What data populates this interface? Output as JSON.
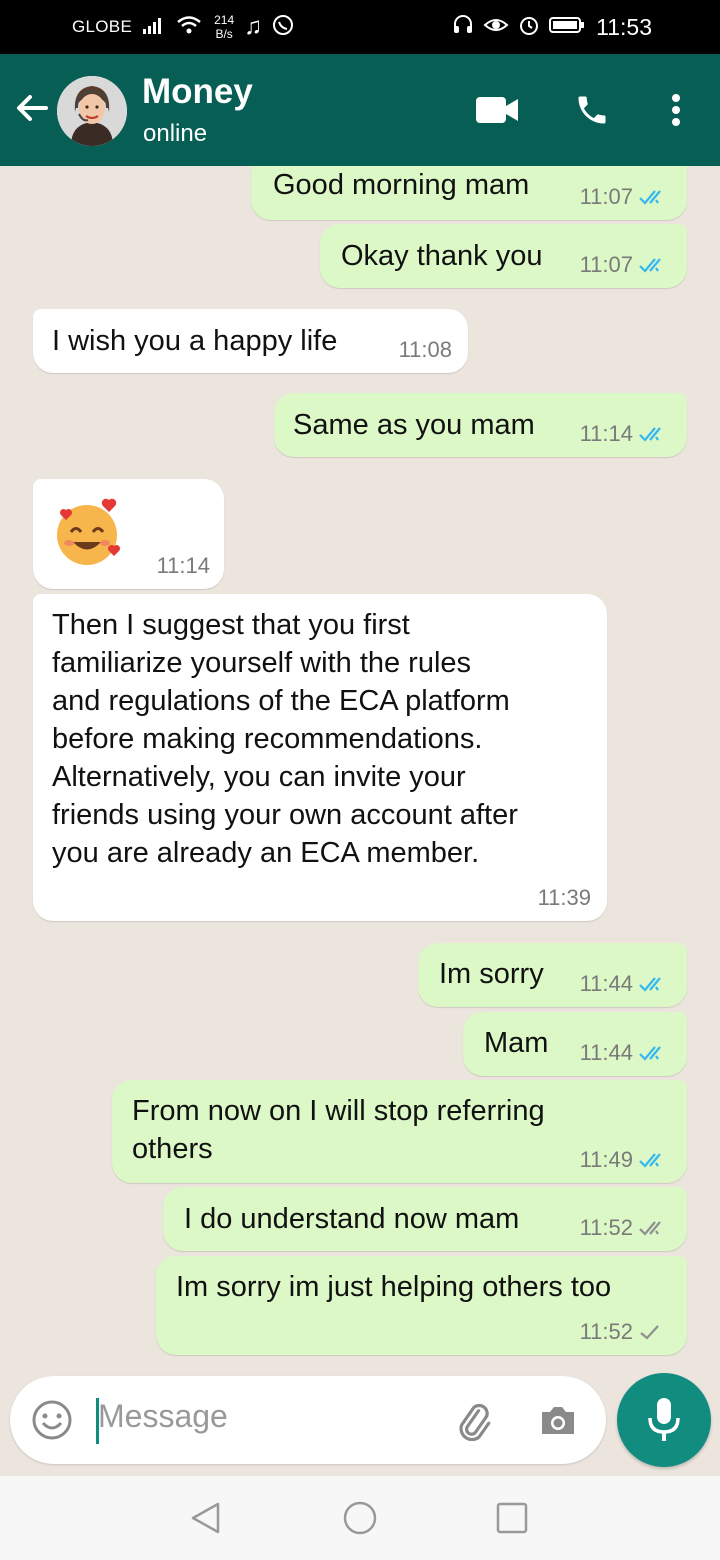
{
  "status_bar": {
    "carrier": "GLOBE",
    "speed_value": "214",
    "speed_unit": "B/s",
    "time": "11:53",
    "icons": [
      "signal-icon",
      "wifi-icon",
      "music-icon",
      "whatsapp-icon",
      "headset-icon",
      "eye-icon",
      "alarm-icon",
      "battery-icon"
    ]
  },
  "header": {
    "contact_name": "Money",
    "presence": "online",
    "icons": [
      "back-arrow-icon",
      "video-call-icon",
      "phone-icon",
      "more-vert-icon"
    ]
  },
  "messages": [
    {
      "dir": "out",
      "text": "Good morning mam",
      "time": "11:07",
      "ticks": "read"
    },
    {
      "dir": "out",
      "text": "Okay thank you",
      "time": "11:07",
      "ticks": "read"
    },
    {
      "dir": "in",
      "text": "I wish you a happy life",
      "time": "11:08"
    },
    {
      "dir": "out",
      "text": "Same as you mam",
      "time": "11:14",
      "ticks": "read"
    },
    {
      "dir": "in",
      "text": "",
      "emoji": "smiling-face-with-hearts",
      "time": "11:14"
    },
    {
      "dir": "in",
      "text": "Then I suggest that you first\nfamiliarize yourself with the rules\nand regulations of the ECA platform\nbefore making recommendations.\nAlternatively, you can invite your\nfriends using your own account after\nyou are already an ECA member.",
      "time": "11:39"
    },
    {
      "dir": "out",
      "text": "Im sorry",
      "time": "11:44",
      "ticks": "read"
    },
    {
      "dir": "out",
      "text": "Mam",
      "time": "11:44",
      "ticks": "read"
    },
    {
      "dir": "out",
      "text": "From now on I will stop referring\nothers",
      "time": "11:49",
      "ticks": "read"
    },
    {
      "dir": "out",
      "text": "I do understand now mam",
      "time": "11:52",
      "ticks": "delivered"
    },
    {
      "dir": "out",
      "text": "Im sorry im just helping others too",
      "time": "11:52",
      "ticks": "sent"
    }
  ],
  "composer": {
    "placeholder": "Message",
    "icons": [
      "emoji-icon",
      "attach-icon",
      "camera-icon",
      "mic-icon"
    ]
  },
  "colors": {
    "header": "#075e54",
    "accent": "#128c7e",
    "outgoing_bubble": "#dcf8c6",
    "incoming_bubble": "#ffffff",
    "wallpaper": "#ece5dd",
    "read_tick": "#34b7f1",
    "unread_tick": "#8f8f8f"
  }
}
